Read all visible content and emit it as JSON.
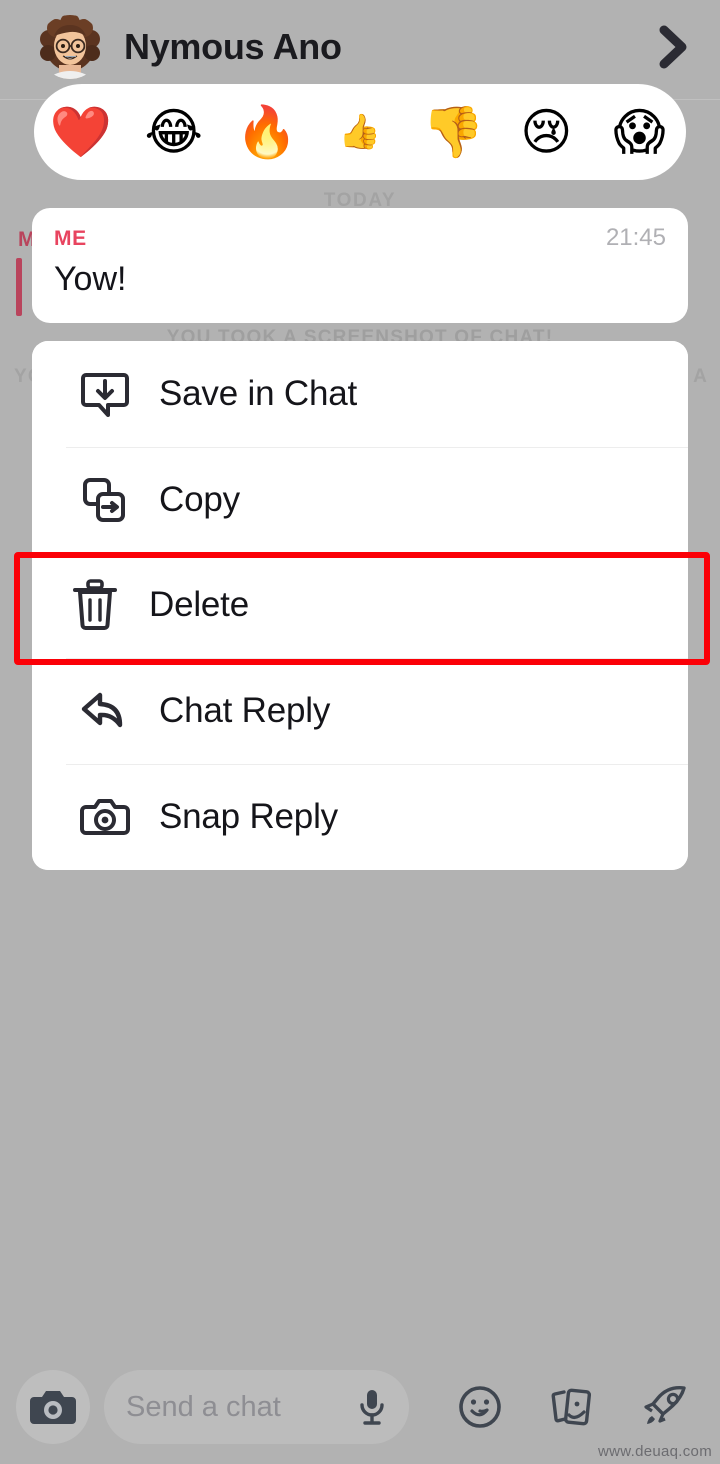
{
  "app": {
    "name": "Snapchat Chat",
    "background_color": "#b2b2b2"
  },
  "header": {
    "contact_name": "Nymous Ano",
    "avatar_name": "bitmoji-avatar",
    "chevron_icon": "chevron-right-icon"
  },
  "reaction_bar": {
    "emojis": [
      {
        "name": "heart-emoji",
        "glyph": "❤️",
        "label": "heart"
      },
      {
        "name": "joy-emoji",
        "glyph": "😂",
        "label": "face with tears of joy"
      },
      {
        "name": "fire-emoji",
        "glyph": "🔥",
        "label": "fire"
      },
      {
        "name": "thumbs-up-emoji",
        "glyph": "👍",
        "label": "thumbs up"
      },
      {
        "name": "thumbs-down-emoji",
        "glyph": "👎",
        "label": "thumbs down"
      },
      {
        "name": "pleading-face-emoji",
        "glyph": "😢",
        "label": "pleading face"
      },
      {
        "name": "shocked-face-emoji",
        "glyph": "😱",
        "label": "shocked face"
      }
    ]
  },
  "background_chat": {
    "day_label": "TODAY",
    "screenshot_note": "YOU TOOK A SCREENSHOT OF CHAT!",
    "obscured_sender": "M",
    "obscured_text_left": "YO",
    "obscured_text_right": "A"
  },
  "message": {
    "sender": "ME",
    "time": "21:45",
    "text": "Yow!",
    "sender_color": "#e8445f"
  },
  "context_menu": {
    "items": [
      {
        "label": "Save in Chat",
        "icon": "save-in-chat-icon",
        "highlighted": false
      },
      {
        "label": "Copy",
        "icon": "copy-icon",
        "highlighted": false
      },
      {
        "label": "Delete",
        "icon": "trash-icon",
        "highlighted": true
      },
      {
        "label": "Chat Reply",
        "icon": "reply-arrow-icon",
        "highlighted": false
      },
      {
        "label": "Snap Reply",
        "icon": "camera-icon",
        "highlighted": false
      }
    ],
    "highlight_color": "#fb0007"
  },
  "toolbar": {
    "camera_icon": "camera-icon",
    "input_placeholder": "Send a chat",
    "mic_icon": "microphone-icon",
    "sticker_icon": "smiley-icon",
    "cards_icon": "cameos-icon",
    "rocket_icon": "rocket-icon"
  },
  "watermark": {
    "text": "www.deuaq.com"
  }
}
